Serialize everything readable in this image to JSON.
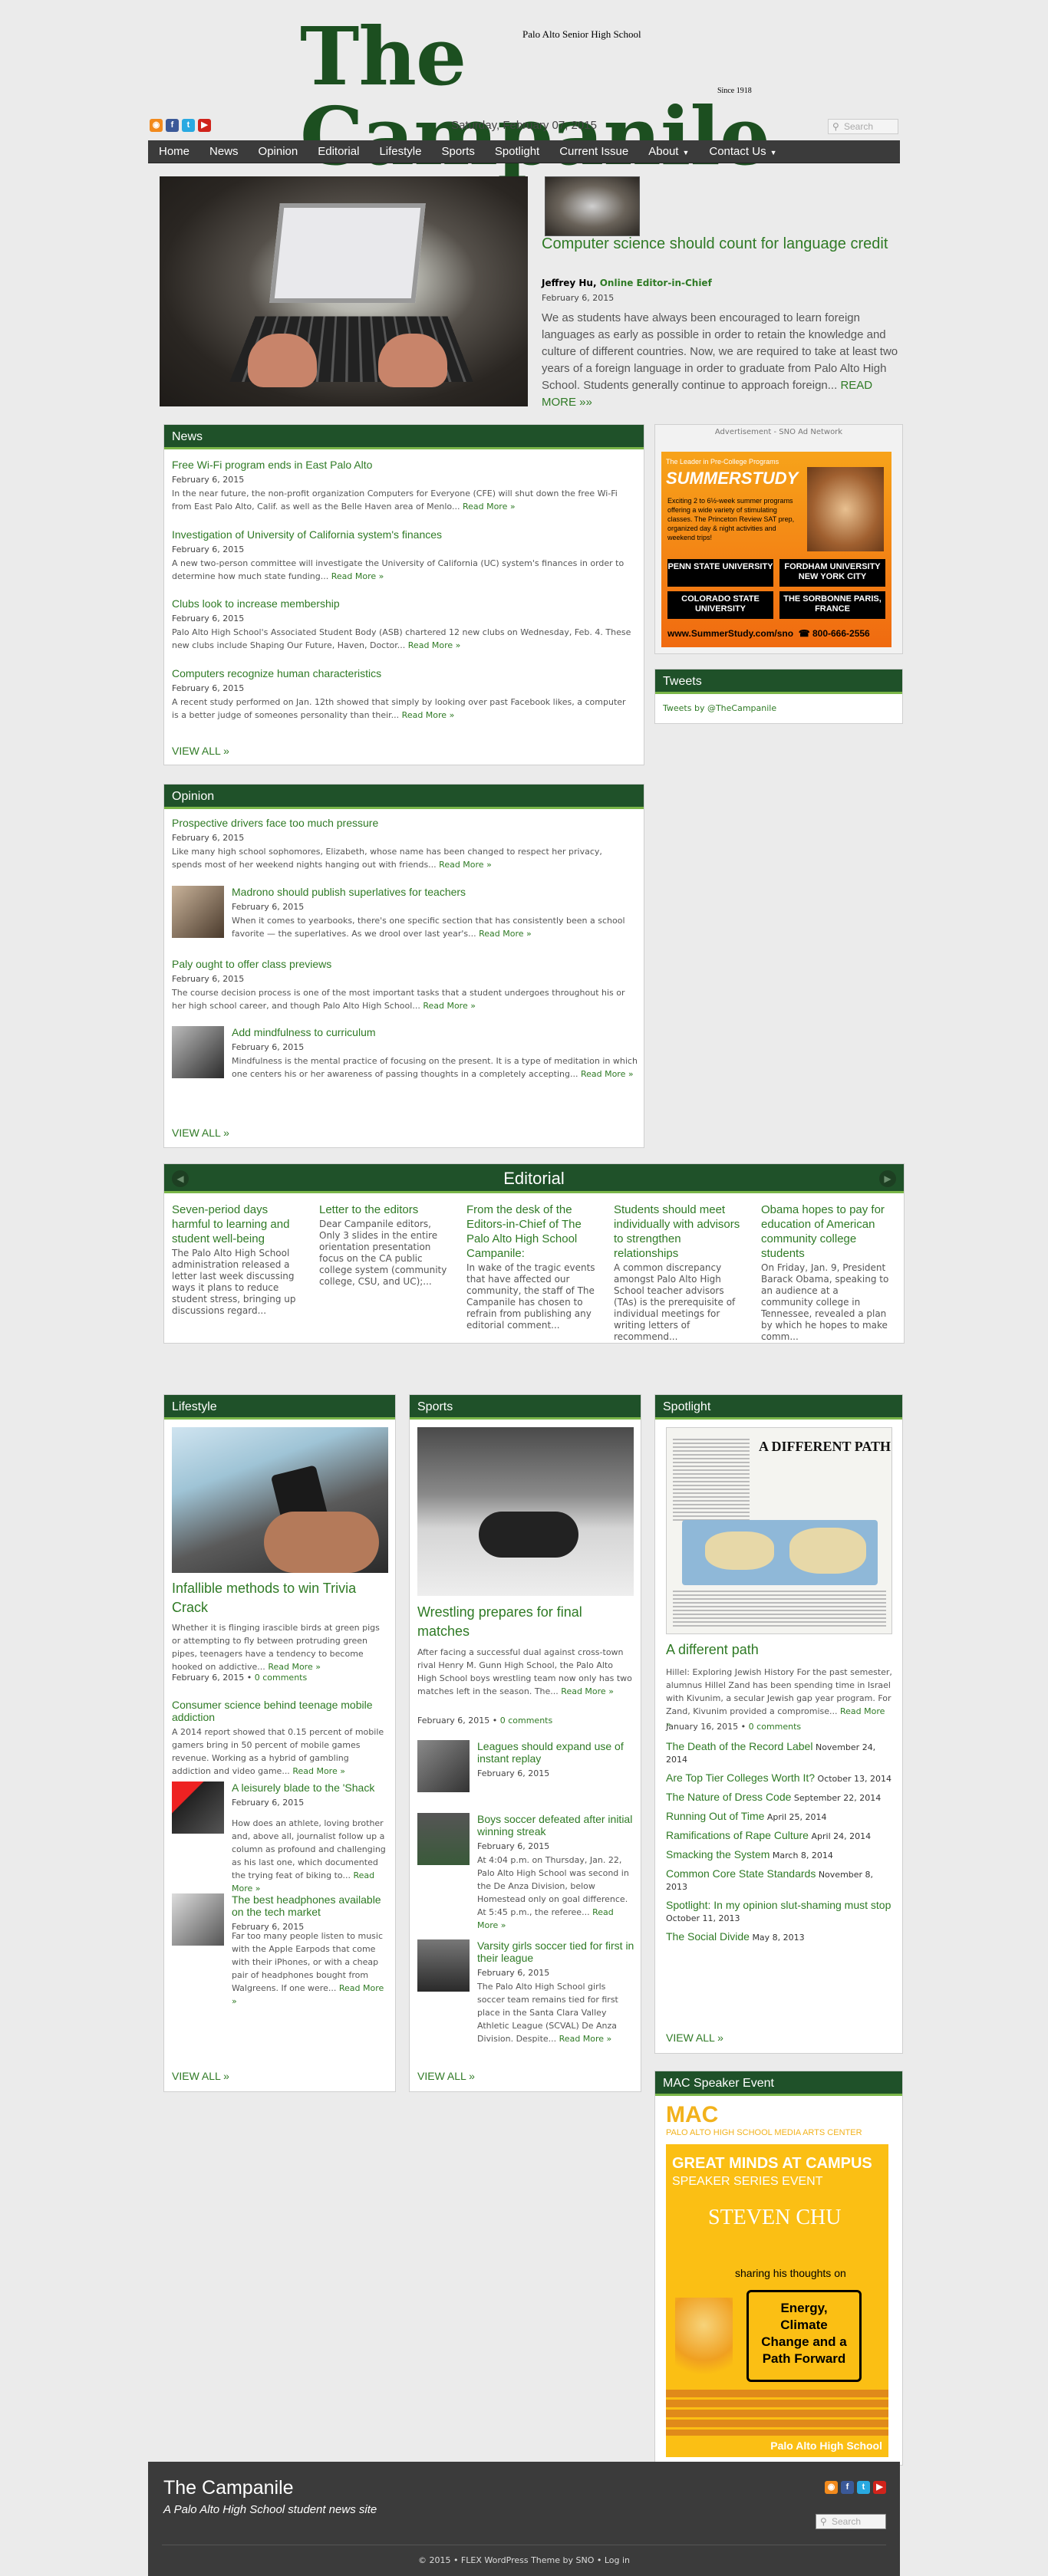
{
  "masthead": {
    "logo": "The Campanile",
    "tagline": "Palo Alto Senior High School",
    "since": "Since 1918",
    "date": "Saturday, February 07, 2015",
    "search_placeholder": "Search",
    "social": [
      "rss",
      "facebook",
      "twitter",
      "youtube"
    ]
  },
  "nav": [
    {
      "label": "Home",
      "dropdown": false
    },
    {
      "label": "News",
      "dropdown": false
    },
    {
      "label": "Opinion",
      "dropdown": false
    },
    {
      "label": "Editorial",
      "dropdown": false
    },
    {
      "label": "Lifestyle",
      "dropdown": false
    },
    {
      "label": "Sports",
      "dropdown": false
    },
    {
      "label": "Spotlight",
      "dropdown": false
    },
    {
      "label": "Current Issue",
      "dropdown": false
    },
    {
      "label": "About",
      "dropdown": true
    },
    {
      "label": "Contact Us",
      "dropdown": true
    }
  ],
  "featured": {
    "title": "Computer science should count for language credit",
    "author": "Jeffrey Hu,",
    "author_role": "Online Editor-in-Chief",
    "date": "February 6, 2015",
    "excerpt": "We as students have always been encouraged to learn foreign languages as early as possible in order to retain the knowledge and culture of different countries. Now, we are required to take at least two years of a foreign language in order to graduate from Palo Alto High School. Students generally continue to approach foreign...",
    "read_more": "READ MORE"
  },
  "news": {
    "heading": "News",
    "view_all": "VIEW ALL",
    "posts": [
      {
        "title": "Free Wi-Fi program ends in East Palo Alto",
        "date": "February 6, 2015",
        "excerpt": "In the near future, the non-profit organization Computers for Everyone (CFE) will shut down the free Wi-Fi from East Palo Alto, Calif. as well as the Belle Haven area of Menlo...",
        "more": "Read More »"
      },
      {
        "title": "Investigation of University of California system's finances",
        "date": "February 6, 2015",
        "excerpt": "A new two-person committee will investigate the University of California (UC) system's finances in order to determine how much state funding...",
        "more": "Read More »"
      },
      {
        "title": "Clubs look to increase membership",
        "date": "February 6, 2015",
        "excerpt": "Palo Alto High School's Associated Student Body (ASB) chartered 12 new clubs on Wednesday, Feb. 4. These new clubs include Shaping Our Future, Haven, Doctor...",
        "more": "Read More »"
      },
      {
        "title": "Computers recognize human characteristics",
        "date": "February 6, 2015",
        "excerpt": "A recent study performed on Jan. 12th showed that simply by looking over past Facebook likes, a computer is a better judge of someones personality than their...",
        "more": "Read More »"
      }
    ]
  },
  "opinion": {
    "heading": "Opinion",
    "view_all": "VIEW ALL",
    "posts": [
      {
        "title": "Prospective drivers face too much pressure",
        "date": "February 6, 2015",
        "excerpt": "Like many high school sophomores, Elizabeth, whose name has been changed to respect her privacy, spends most of her weekend nights hanging out with friends...",
        "more": "Read More »"
      },
      {
        "title": "Madrono should publish superlatives for teachers",
        "date": "February 6, 2015",
        "excerpt": "When it comes to yearbooks, there's one specific section that has consistently been a school favorite — the superlatives. As we drool over last year's...",
        "more": "Read More »"
      },
      {
        "title": "Paly ought to offer class previews",
        "date": "February 6, 2015",
        "excerpt": "The course decision process is one of the most important tasks that a student undergoes throughout his or her high school career, and though Palo Alto High School...",
        "more": "Read More »"
      },
      {
        "title": "Add mindfulness to curriculum",
        "date": "February 6, 2015",
        "excerpt": "Mindfulness is the mental practice of focusing on the present. It is a type of meditation in which one centers his or her awareness of passing thoughts in a completely accepting...",
        "more": "Read More »"
      }
    ]
  },
  "editorial": {
    "heading": "Editorial",
    "items": [
      {
        "title": "Seven-period days harmful to learning and student well-being",
        "excerpt": "The Palo Alto High School administration released a letter last week discussing ways it plans to reduce student stress, bringing up discussions regard..."
      },
      {
        "title": "Letter to the editors",
        "excerpt": "Dear Campanile editors, Only 3 slides in the entire orientation presentation focus on the CA public college system (community college, CSU, and UC);..."
      },
      {
        "title": "From the desk of the Editors-in-Chief of The Palo Alto High School Campanile:",
        "excerpt": "In wake of the tragic events that have affected our community, the staff of The Campanile has chosen to refrain from publishing any editorial comment..."
      },
      {
        "title": "Students should meet individually with advisors to strengthen relationships",
        "excerpt": "A common discrepancy amongst Palo Alto High School teacher advisors (TAs) is the prerequisite of individual meetings for writing letters of recommend..."
      },
      {
        "title": "Obama hopes to pay for education of American community college students",
        "excerpt": "On Friday, Jan. 9, President Barack Obama, speaking to an audience at a community college in Tennessee, revealed a plan by which he hopes to make comm..."
      }
    ]
  },
  "lifestyle": {
    "heading": "Lifestyle",
    "view_all": "VIEW ALL",
    "lead": {
      "title": "Infallible methods to win Trivia Crack",
      "excerpt": "Whether it is flinging irascible birds at green pigs or attempting to fly between protruding green pipes, teenagers have a tendency to become hooked on addictive...",
      "more": "Read More »",
      "date": "February 6, 2015",
      "comments": "0 comments"
    },
    "posts": [
      {
        "title": "Consumer science behind teenage mobile addiction",
        "excerpt": "A 2014 report showed that 0.15 percent of mobile gamers bring in 50 percent of mobile games revenue. Working as a hybrid of gambling addiction and video game...",
        "more": "Read More »"
      },
      {
        "title": "A leisurely blade to the 'Shack",
        "date": "February 6, 2015",
        "excerpt": "How does an athlete, loving brother and, above all, journalist follow up a column as profound and challenging as his last one, which documented the trying feat of biking to...",
        "more": "Read More »"
      },
      {
        "title": "The best headphones available on the tech market",
        "date": "February 6, 2015",
        "excerpt": "Far too many people listen to music with the Apple Earpods that come with their iPhones, or with a cheap pair of headphones bought from Walgreens. If one were...",
        "more": "Read More »"
      }
    ]
  },
  "sports": {
    "heading": "Sports",
    "view_all": "VIEW ALL",
    "lead": {
      "title": "Wrestling prepares for final matches",
      "excerpt": "After facing a successful dual against cross-town rival Henry M. Gunn High School, the Palo Alto High School boys wrestling team now only has two matches left in the season. The...",
      "more": "Read More »",
      "date": "February 6, 2015",
      "comments": "0 comments"
    },
    "posts": [
      {
        "title": "Leagues should expand use of instant replay",
        "date": "February 6, 2015"
      },
      {
        "title": "Boys soccer defeated after initial winning streak",
        "date": "February 6, 2015",
        "excerpt": "At 4:04 p.m. on Thursday, Jan. 22, Palo Alto High School was second in the De Anza Division, below Homestead only on goal difference. At 5:45 p.m., the referee...",
        "more": "Read More »"
      },
      {
        "title": "Varsity girls soccer tied for first in their league",
        "date": "February 6, 2015",
        "excerpt": "The Palo Alto High School girls soccer team remains tied for first place in the Santa Clara Valley Athletic League (SCVAL) De Anza Division. Despite...",
        "more": "Read More »"
      }
    ]
  },
  "spotlight": {
    "heading": "Spotlight",
    "view_all": "VIEW ALL",
    "lead": {
      "title": "A different path",
      "excerpt": "Hillel: Exploring Jewish History For the past semester, alumnus Hillel Zand has been spending time in Israel with Kivunim, a secular Jewish gap year program. For Zand, Kivunim provided a compromise...",
      "more": "Read More »",
      "date": "January 16, 2015",
      "comments": "0 comments",
      "spread_title": "A DIFFERENT PATH"
    },
    "links": [
      {
        "title": "The Death of the Record Label",
        "date": "November 24, 2014"
      },
      {
        "title": "Are Top Tier Colleges Worth It?",
        "date": "October 13, 2014"
      },
      {
        "title": "The Nature of Dress Code",
        "date": "September 22, 2014"
      },
      {
        "title": "Running Out of Time",
        "date": "April 25, 2014"
      },
      {
        "title": "Ramifications of Rape Culture",
        "date": "April 24, 2014"
      },
      {
        "title": "Smacking the System",
        "date": "March 8, 2014"
      },
      {
        "title": "Common Core State Standards",
        "date": "November 8, 2013"
      },
      {
        "title": "Spotlight: In my opinion slut-shaming must stop",
        "date": "October 11, 2013"
      },
      {
        "title": "The Social Divide",
        "date": "May 8, 2013"
      }
    ]
  },
  "sidebar": {
    "ad_label": "Advertisement - SNO Ad Network",
    "ad": {
      "header": "The Leader in Pre-College Programs",
      "brand": "SUMMERSTUDY",
      "blurb": "Exciting 2 to 6½-week summer programs offering a wide variety of stimulating classes. The Princeton Review SAT prep, organized day & night activities and weekend trips!",
      "schools": [
        "PENN STATE UNIVERSITY",
        "FORDHAM UNIVERSITY NEW YORK CITY",
        "COLORADO STATE UNIVERSITY",
        "THE SORBONNE PARIS, FRANCE"
      ],
      "url": "www.SummerStudy.com/sno",
      "phone": "800-666-2556"
    },
    "tweets_heading": "Tweets",
    "tweets_link": "Tweets by @TheCampanile",
    "mac_heading": "MAC Speaker Event",
    "mac": {
      "logo": "MAC",
      "org": "PALO ALTO HIGH SCHOOL MEDIA ARTS CENTER",
      "event_title": "GREAT MINDS AT CAMPUS",
      "event_sub": "SPEAKER SERIES EVENT",
      "speaker": "STEVEN CHU",
      "thoughts": "sharing his thoughts on",
      "talk": "Energy, Climate Change and a Path Forward",
      "footer": "Palo Alto High School"
    }
  },
  "footer": {
    "title": "The Campanile",
    "subtitle": "A Palo Alto High School student news site",
    "search_placeholder": "Search",
    "copyright": "© 2015 • FLEX WordPress Theme by SNO • Log in"
  }
}
